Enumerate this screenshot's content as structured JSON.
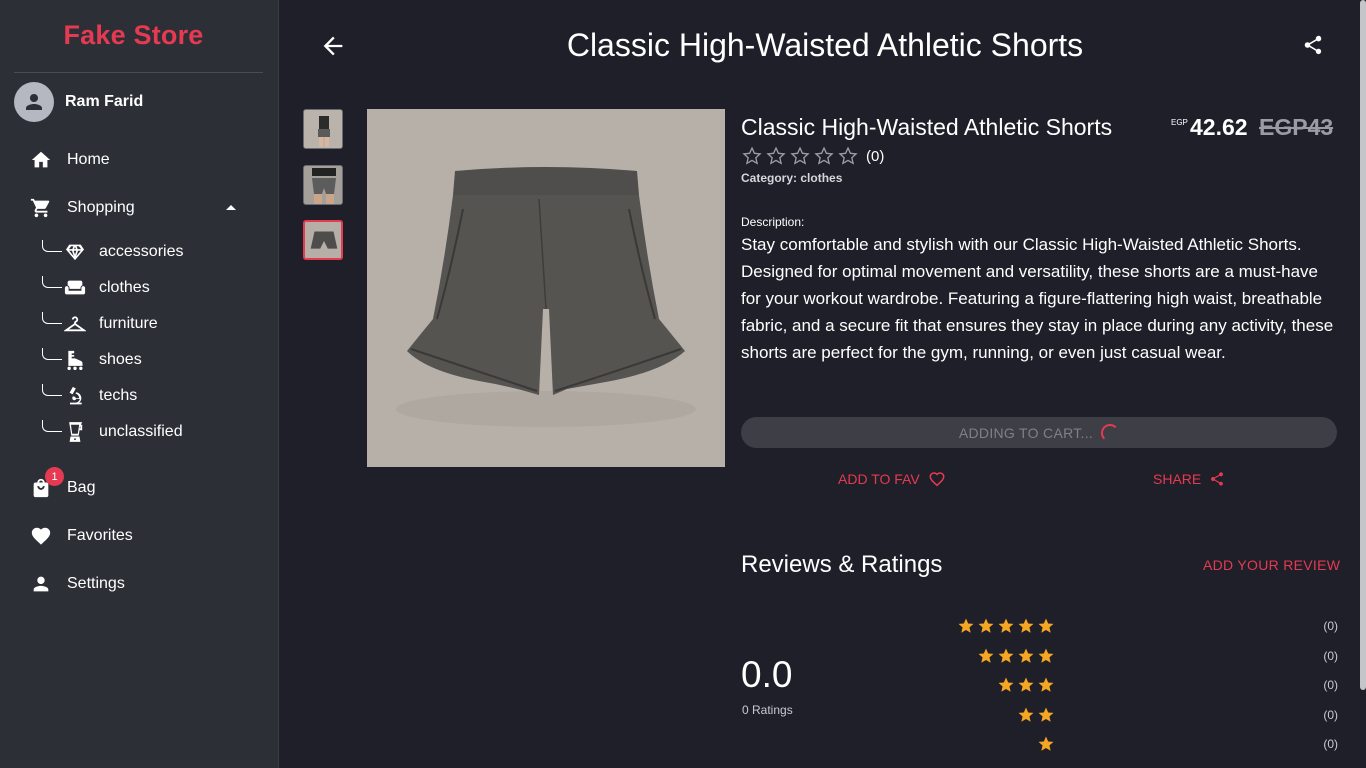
{
  "app": {
    "brand": "Fake Store"
  },
  "user": {
    "name": "Ram Farid"
  },
  "nav": {
    "home": "Home",
    "shopping": "Shopping",
    "categories": [
      "accessories",
      "clothes",
      "furniture",
      "shoes",
      "techs",
      "unclassified"
    ],
    "bag": "Bag",
    "bag_badge": "1",
    "favorites": "Favorites",
    "settings": "Settings"
  },
  "header": {
    "title": "Classic High-Waisted Athletic Shorts"
  },
  "product": {
    "title": "Classic High-Waisted Athletic Shorts",
    "currency_small": "EGP",
    "price": "42.62",
    "old_price": "EGP43",
    "rating_count": "(0)",
    "category_label": "Category:",
    "category": "clothes",
    "description_label": "Description:",
    "description": "Stay comfortable and stylish with our Classic High-Waisted Athletic Shorts. Designed for optimal movement and versatility, these shorts are a must-have for your workout wardrobe. Featuring a figure-flattering high waist, breathable fabric, and a secure fit that ensures they stay in place during any activity, these shorts are perfect for the gym, running, or even just casual wear.",
    "stars_filled": 0,
    "thumbnails": 3,
    "active_thumbnail": 3
  },
  "actions": {
    "cart_label": "ADDING TO CART...",
    "fav_label": "ADD TO FAV",
    "share_label": "SHARE"
  },
  "reviews": {
    "title": "Reviews & Ratings",
    "add_label": "ADD YOUR REVIEW",
    "average": "0.0",
    "ratings_label": "0 Ratings",
    "breakdown": [
      {
        "stars": 5,
        "count": "(0)"
      },
      {
        "stars": 4,
        "count": "(0)"
      },
      {
        "stars": 3,
        "count": "(0)"
      },
      {
        "stars": 2,
        "count": "(0)"
      },
      {
        "stars": 1,
        "count": "(0)"
      }
    ]
  },
  "colors": {
    "accent": "#e53a51",
    "star": "#f5a623",
    "sidebar": "#2d2f37",
    "background": "#1f1f29"
  }
}
